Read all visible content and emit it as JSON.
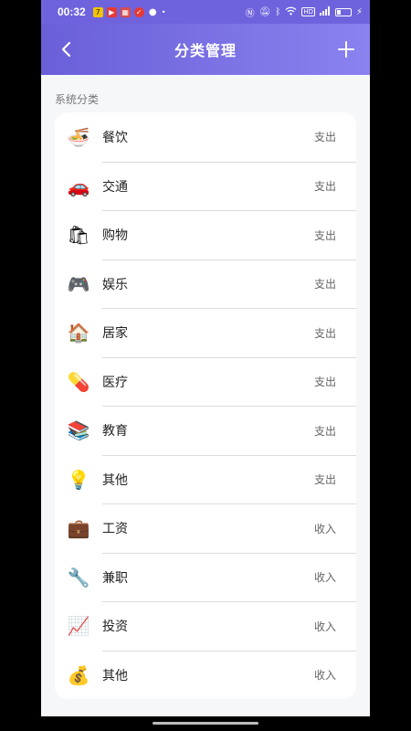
{
  "status_bar": {
    "time": "00:32",
    "icons": [
      "app-7-icon",
      "youtube-icon",
      "gallery-icon",
      "red-app-icon",
      "wechat-icon",
      "dot-icon",
      "nfc-icon",
      "mute-icon",
      "bluetooth-icon",
      "wifi-icon",
      "hd-icon",
      "signal-icon",
      "battery-icon",
      "charging-icon"
    ],
    "battery_level": 0.3
  },
  "header": {
    "title": "分类管理",
    "back_icon": "chevron-left-icon",
    "add_icon": "plus-icon",
    "gradient": [
      "#6a5fd8",
      "#8a82ef"
    ]
  },
  "section": {
    "label": "系统分类"
  },
  "categories": [
    {
      "emoji": "🍜",
      "icon": "noodles-icon",
      "name": "餐饮",
      "type": "支出"
    },
    {
      "emoji": "🚗",
      "icon": "car-icon",
      "name": "交通",
      "type": "支出"
    },
    {
      "emoji": "🛍",
      "icon": "shopping-bags-icon",
      "name": "购物",
      "type": "支出"
    },
    {
      "emoji": "🎮",
      "icon": "gamepad-icon",
      "name": "娱乐",
      "type": "支出"
    },
    {
      "emoji": "🏠",
      "icon": "house-icon",
      "name": "居家",
      "type": "支出"
    },
    {
      "emoji": "💊",
      "icon": "pill-icon",
      "name": "医疗",
      "type": "支出"
    },
    {
      "emoji": "📚",
      "icon": "books-icon",
      "name": "教育",
      "type": "支出"
    },
    {
      "emoji": "💡",
      "icon": "lightbulb-icon",
      "name": "其他",
      "type": "支出"
    },
    {
      "emoji": "💼",
      "icon": "briefcase-icon",
      "name": "工资",
      "type": "收入"
    },
    {
      "emoji": "🔧",
      "icon": "wrench-icon",
      "name": "兼职",
      "type": "收入"
    },
    {
      "emoji": "📈",
      "icon": "chart-up-icon",
      "name": "投资",
      "type": "收入"
    },
    {
      "emoji": "💰",
      "icon": "money-bag-icon",
      "name": "其他",
      "type": "收入"
    }
  ]
}
